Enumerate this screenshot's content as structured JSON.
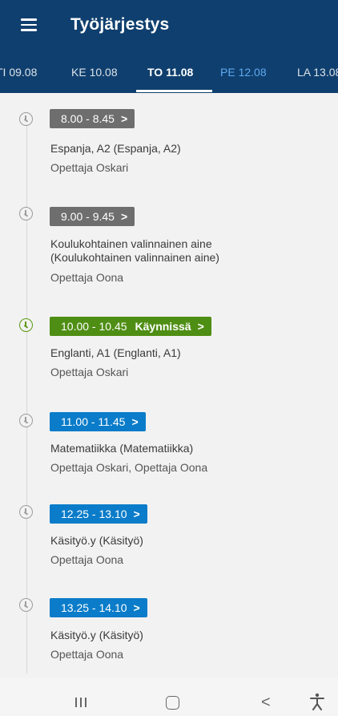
{
  "app": {
    "title": "Työjärjestys"
  },
  "tabs": [
    {
      "label": "TI 09.08"
    },
    {
      "label": "KE 10.08"
    },
    {
      "label": "TO 11.08"
    },
    {
      "label": "PE 12.08"
    },
    {
      "label": "LA 13.08"
    }
  ],
  "lessons": [
    {
      "time": "8.00 - 8.45",
      "subject": "Espanja, A2  (Espanja, A2)",
      "teacher": "Opettaja Oskari"
    },
    {
      "time": "9.00 - 9.45",
      "subject": "Koulukohtainen valinnainen aine (Koulukohtainen valinnainen aine)",
      "teacher": "Opettaja Oona"
    },
    {
      "time": "10.00 - 10.45",
      "status": "Käynnissä",
      "subject": "Englanti, A1  (Englanti, A1)",
      "teacher": "Opettaja Oskari"
    },
    {
      "time": "11.00 - 11.45",
      "subject": "Matematiikka  (Matematiikka)",
      "teacher": "Opettaja Oskari, Opettaja Oona"
    },
    {
      "time": "12.25 - 13.10",
      "subject": "Käsityö.y  (Käsityö)",
      "teacher": "Opettaja Oona"
    },
    {
      "time": "13.25 - 14.10",
      "subject": "Käsityö.y  (Käsityö)",
      "teacher": "Opettaja Oona"
    }
  ],
  "chevron": ">",
  "nav": {
    "back": "<",
    "accessibility": "🯅"
  },
  "colors": {
    "appbar": "#0f3f6e",
    "past_badge": "#6e6e6e",
    "current_badge": "#4f8e14",
    "future_badge": "#0a7cc9"
  }
}
